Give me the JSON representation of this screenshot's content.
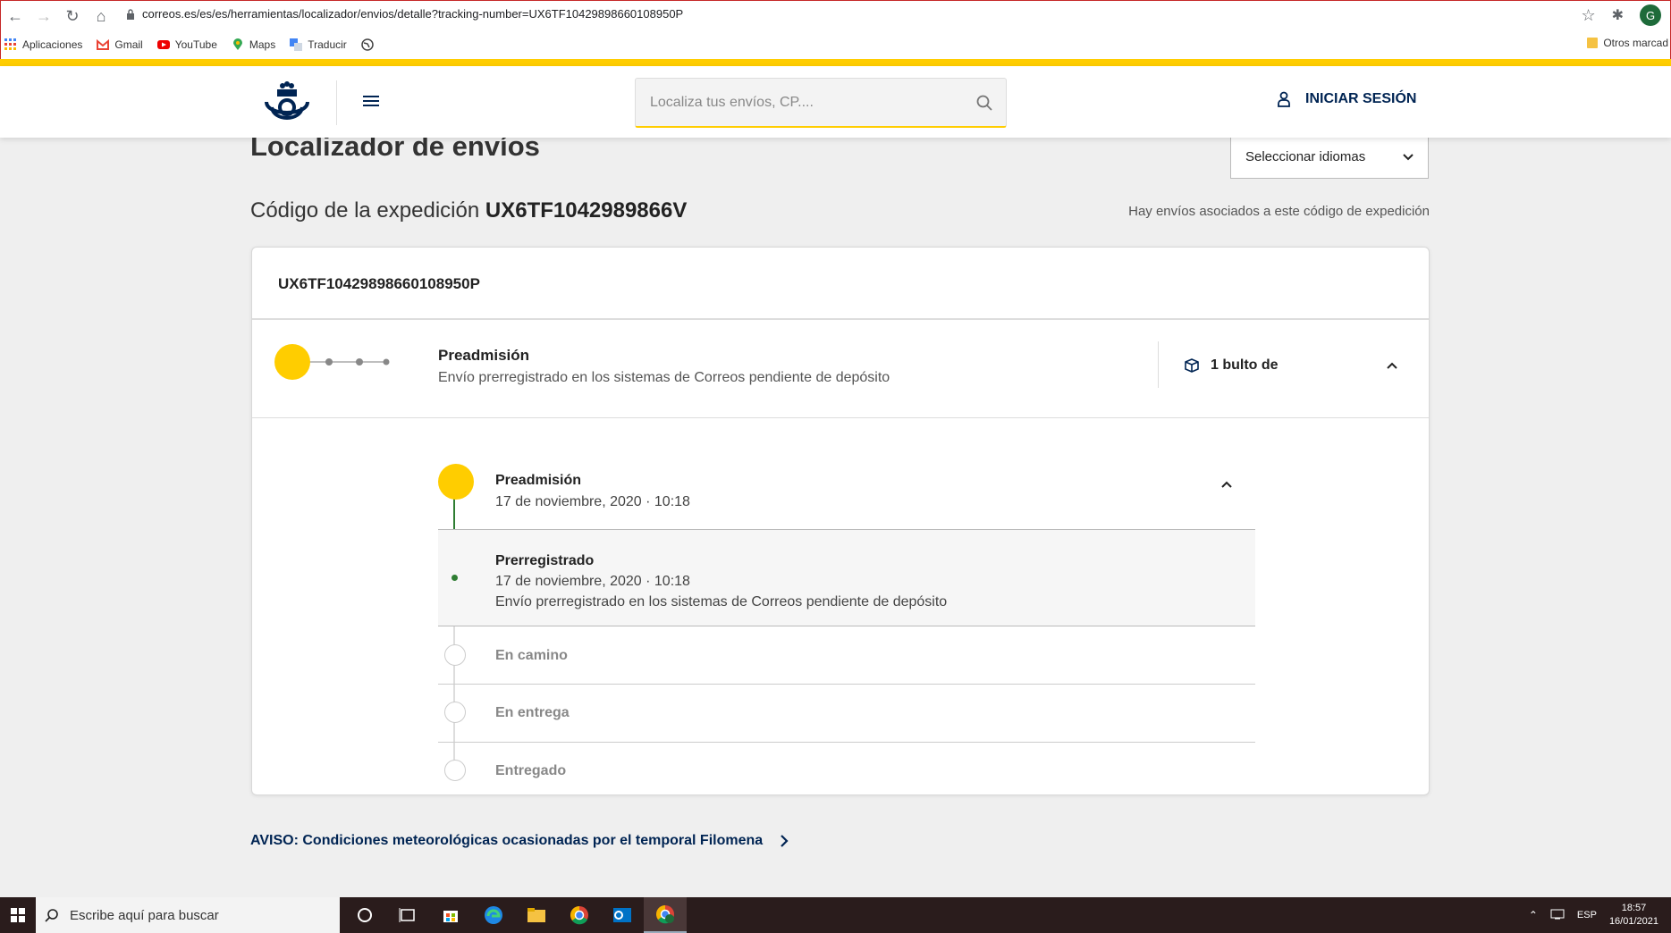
{
  "browser": {
    "url": "correos.es/es/es/herramientas/localizador/envios/detalle?tracking-number=UX6TF10429898660108950P",
    "profile_initial": "G",
    "bookmarks": [
      {
        "label": "Aplicaciones",
        "icon": "apps-grid-icon"
      },
      {
        "label": "Gmail",
        "icon": "gmail-icon"
      },
      {
        "label": "YouTube",
        "icon": "youtube-icon"
      },
      {
        "label": "Maps",
        "icon": "maps-pin-icon"
      },
      {
        "label": "Traducir",
        "icon": "translate-icon"
      }
    ],
    "other_bookmarks": "Otros marcad"
  },
  "header": {
    "search_placeholder": "Localiza tus envíos, CP....",
    "login_label": "INICIAR SESIÓN"
  },
  "main": {
    "title": "Localizador de envíos",
    "language_select": "Seleccionar idiomas",
    "expedition_label": "Código de la expedición",
    "expedition_code": "UX6TF1042989866V",
    "associated_note": "Hay envíos asociados a este código de expedición",
    "shipment": {
      "tracking_number": "UX6TF10429898660108950P",
      "status_title": "Preadmisión",
      "status_desc": "Envío prerregistrado en los sistemas de Correos pendiente de depósito",
      "packages": "1 bulto de",
      "timeline": {
        "current": {
          "title": "Preadmisión",
          "date": "17 de noviembre, 2020 · 10:18"
        },
        "event": {
          "title": "Prerregistrado",
          "date": "17 de noviembre, 2020 · 10:18",
          "desc": "Envío prerregistrado en los sistemas de Correos pendiente de depósito"
        },
        "steps": [
          "En camino",
          "En entrega",
          "Entregado"
        ]
      }
    },
    "notice": "AVISO: Condiciones meteorológicas ocasionadas por el temporal Filomena"
  },
  "taskbar": {
    "search_placeholder": "Escribe aquí para buscar",
    "language": "ESP",
    "time": "18:57",
    "date": "16/01/2021"
  },
  "colors": {
    "brand_yellow": "#ffcd00",
    "brand_blue": "#002453",
    "progress_green": "#2e7d32"
  }
}
